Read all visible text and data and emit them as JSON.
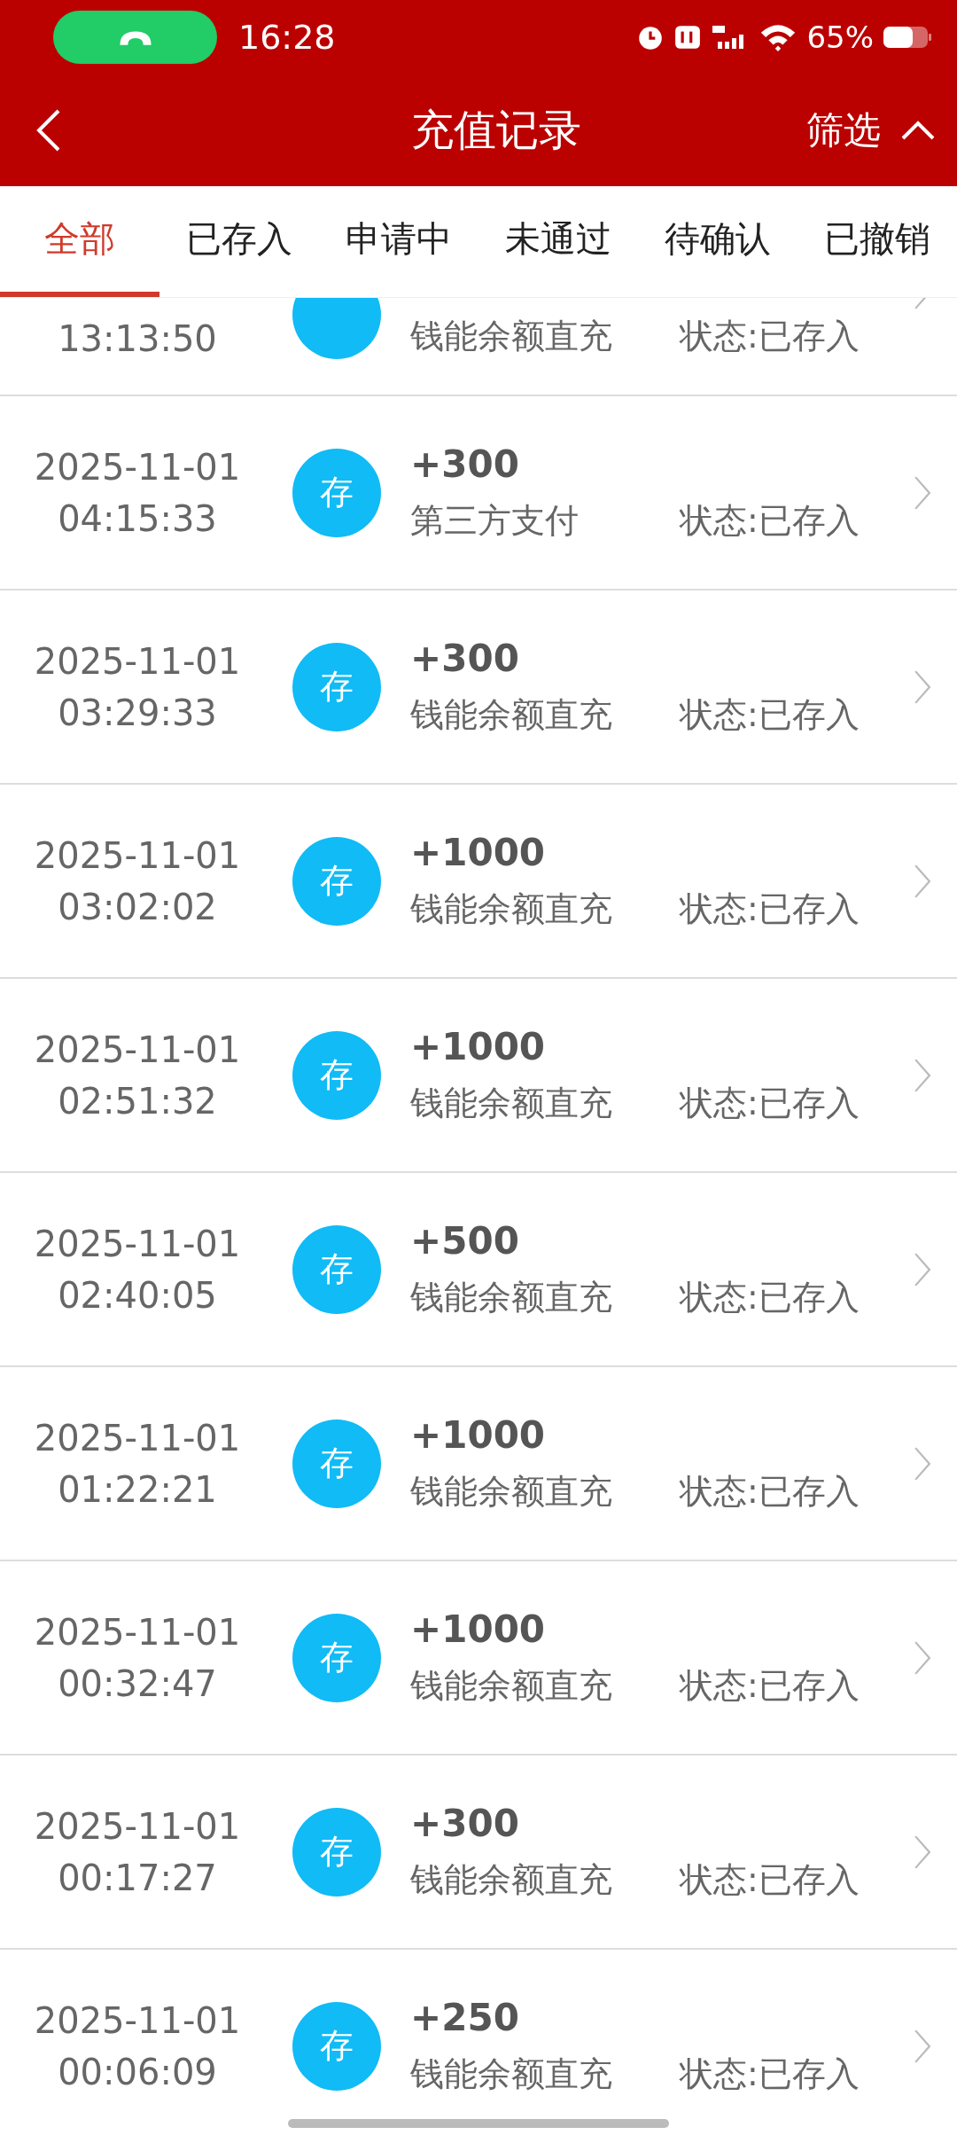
{
  "status_bar": {
    "time": "16:28",
    "battery": "65%"
  },
  "header": {
    "title": "充值记录",
    "filter": "筛选"
  },
  "tabs": [
    {
      "label": "全部",
      "selected": true
    },
    {
      "label": "已存入",
      "selected": false
    },
    {
      "label": "申请中",
      "selected": false
    },
    {
      "label": "未通过",
      "selected": false
    },
    {
      "label": "待确认",
      "selected": false
    },
    {
      "label": "已撤销",
      "selected": false
    }
  ],
  "records": [
    {
      "kind": "partial",
      "time": "13:13:50",
      "method": "钱能余额直充",
      "status": "状态:已存入"
    },
    {
      "kind": "full",
      "date": "2025-11-01",
      "time": "04:15:33",
      "badge": "存",
      "amount": "+300",
      "method": "第三方支付",
      "status": "状态:已存入"
    },
    {
      "kind": "full",
      "date": "2025-11-01",
      "time": "03:29:33",
      "badge": "存",
      "amount": "+300",
      "method": "钱能余额直充",
      "status": "状态:已存入"
    },
    {
      "kind": "full",
      "date": "2025-11-01",
      "time": "03:02:02",
      "badge": "存",
      "amount": "+1000",
      "method": "钱能余额直充",
      "status": "状态:已存入"
    },
    {
      "kind": "full",
      "date": "2025-11-01",
      "time": "02:51:32",
      "badge": "存",
      "amount": "+1000",
      "method": "钱能余额直充",
      "status": "状态:已存入"
    },
    {
      "kind": "full",
      "date": "2025-11-01",
      "time": "02:40:05",
      "badge": "存",
      "amount": "+500",
      "method": "钱能余额直充",
      "status": "状态:已存入"
    },
    {
      "kind": "full",
      "date": "2025-11-01",
      "time": "01:22:21",
      "badge": "存",
      "amount": "+1000",
      "method": "钱能余额直充",
      "status": "状态:已存入"
    },
    {
      "kind": "full",
      "date": "2025-11-01",
      "time": "00:32:47",
      "badge": "存",
      "amount": "+1000",
      "method": "钱能余额直充",
      "status": "状态:已存入"
    },
    {
      "kind": "full",
      "date": "2025-11-01",
      "time": "00:17:27",
      "badge": "存",
      "amount": "+300",
      "method": "钱能余额直充",
      "status": "状态:已存入"
    },
    {
      "kind": "full",
      "date": "2025-11-01",
      "time": "00:06:09",
      "badge": "存",
      "amount": "+250",
      "method": "钱能余额直充",
      "status": "状态:已存入"
    }
  ]
}
